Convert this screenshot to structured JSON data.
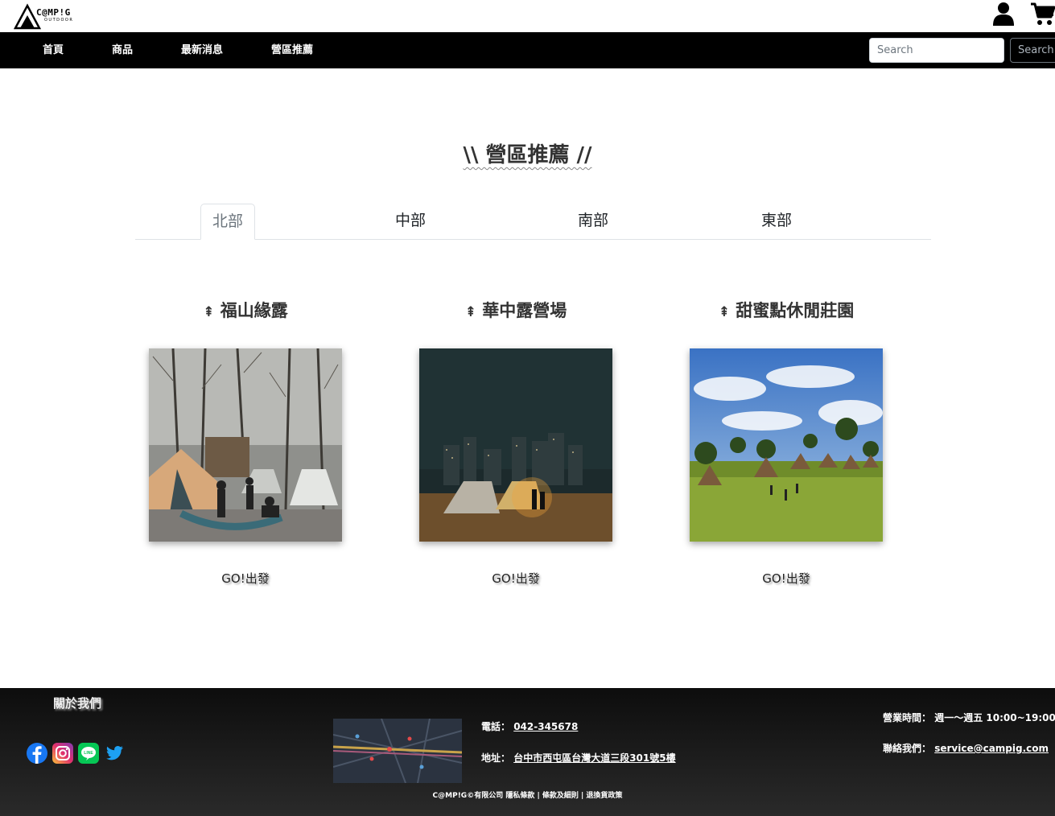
{
  "brand": {
    "logo_text": "C@MP!G",
    "logo_sub": "OUTDOOR"
  },
  "header": {
    "user_icon": "user-icon",
    "cart_icon": "cart-icon"
  },
  "nav": {
    "items": [
      {
        "label": "首頁"
      },
      {
        "label": "商品"
      },
      {
        "label": "最新消息"
      },
      {
        "label": "營區推薦"
      }
    ],
    "search_placeholder": "Search",
    "search_button": "Search"
  },
  "section": {
    "title": "\\\\ 營區推薦 //"
  },
  "tabs": [
    {
      "label": "北部",
      "active": true
    },
    {
      "label": "中部",
      "active": false
    },
    {
      "label": "南部",
      "active": false
    },
    {
      "label": "東部",
      "active": false
    }
  ],
  "campsites": [
    {
      "name": "福山緣露",
      "icon": "tree-icon",
      "cta": "GO!出發"
    },
    {
      "name": "華中露營場",
      "icon": "tree-icon",
      "cta": "GO!出發"
    },
    {
      "name": "甜蜜點休閒莊園",
      "icon": "tree-icon",
      "cta": "GO!出發"
    }
  ],
  "footer": {
    "about": "關於我們",
    "social": [
      "facebook-icon",
      "instagram-icon",
      "line-icon",
      "twitter-icon"
    ],
    "phone_label": "電話：",
    "phone": "042-345678",
    "address_label": "地址：",
    "address": "台中市西屯區台灣大道三段301號5樓",
    "hours_label": "營業時間：",
    "hours": "週一～週五 10:00~19:00",
    "contact_label": "聯絡我們：",
    "email": "service@campig.com",
    "copyright": "C@MP!G©有限公司 隱私條款 | 條款及細則 | 退換貨政策"
  },
  "colors": {
    "nav_bg": "#000000",
    "footer_bg": "#1a1a1a",
    "text_dark": "#333333"
  }
}
